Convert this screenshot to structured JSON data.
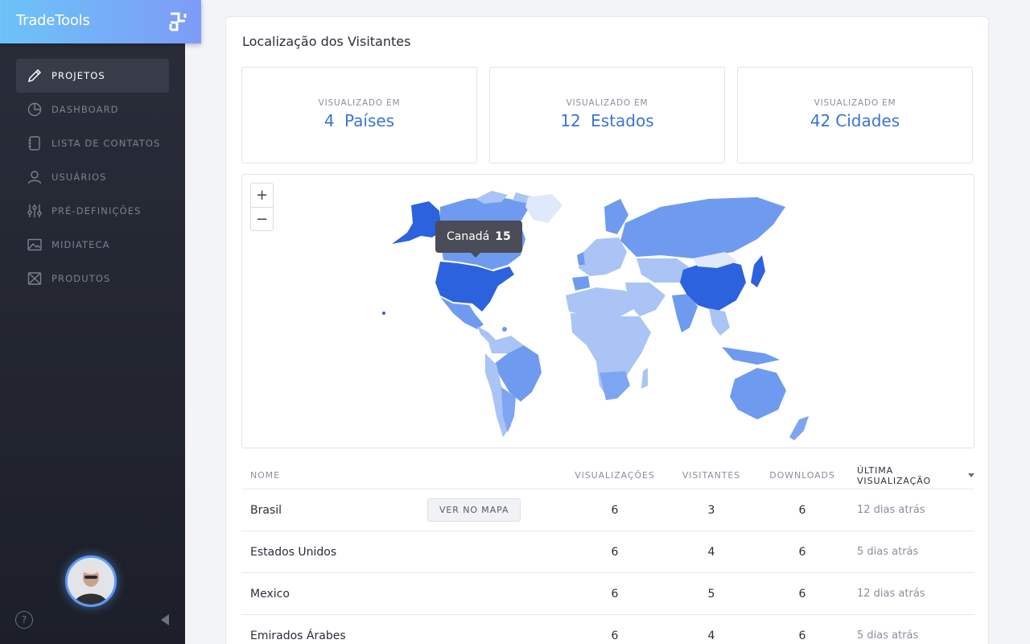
{
  "brand": {
    "name": "TradeTools"
  },
  "sidebar": {
    "items": [
      {
        "label": "PROJETOS",
        "icon": "pencil-icon",
        "active": true
      },
      {
        "label": "DASHBOARD",
        "icon": "pie-chart-icon",
        "active": false
      },
      {
        "label": "LISTA DE CONTATOS",
        "icon": "address-book-icon",
        "active": false
      },
      {
        "label": "USUÁRIOS",
        "icon": "user-icon",
        "active": false
      },
      {
        "label": "PRÉ-DEFINIÇÕES",
        "icon": "sliders-icon",
        "active": false
      },
      {
        "label": "MIDIATECA",
        "icon": "image-icon",
        "active": false
      },
      {
        "label": "PRODUTOS",
        "icon": "box-icon",
        "active": false
      }
    ],
    "help_label": "?"
  },
  "card": {
    "title": "Localização dos Visitantes"
  },
  "stats": [
    {
      "caption": "VISUALIZADO EM",
      "number": "4",
      "unit": "Países"
    },
    {
      "caption": "VISUALIZADO EM",
      "number": "12",
      "unit": "Estados"
    },
    {
      "caption": "VISUALIZADO EM",
      "number": "42",
      "unit": "Cidades"
    }
  ],
  "map": {
    "zoom_in": "+",
    "zoom_out": "−",
    "tooltip": {
      "country": "Canadá",
      "value": "15"
    },
    "colors": {
      "low": "#a9c4f5",
      "mid": "#6e9bf0",
      "high": "#2c62dd"
    }
  },
  "table": {
    "headers": {
      "name": "NOME",
      "views": "VISUALIZAÇÕES",
      "visitors": "VISITANTES",
      "downloads": "DOWNLOADS",
      "last": "ÚLTIMA VISUALIZAÇÃO"
    },
    "map_button": "VER NO MAPA",
    "rows": [
      {
        "name": "Brasil",
        "views": "6",
        "visitors": "3",
        "downloads": "6",
        "last": "12 dias atrás"
      },
      {
        "name": "Estados Unidos",
        "views": "6",
        "visitors": "4",
        "downloads": "6",
        "last": "5 dias atrás"
      },
      {
        "name": "Mexico",
        "views": "6",
        "visitors": "5",
        "downloads": "6",
        "last": "12 dias atrás"
      },
      {
        "name": "Emirados Árabes",
        "views": "6",
        "visitors": "4",
        "downloads": "6",
        "last": "5 dias atrás"
      }
    ]
  }
}
